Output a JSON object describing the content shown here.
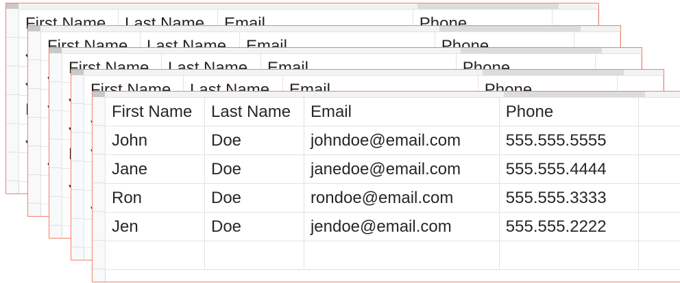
{
  "spreadsheet": {
    "columns": [
      "First Name",
      "Last Name",
      "Email",
      "Phone"
    ],
    "rows": [
      [
        "John",
        "Doe",
        "johndoe@email.com",
        "555.555.5555"
      ],
      [
        "Jane",
        "Doe",
        "janedoe@email.com",
        "555.555.4444"
      ],
      [
        "Ron",
        "Doe",
        "rondoe@email.com",
        "555.555.3333"
      ],
      [
        "Jen",
        "Doe",
        "jendoe@email.com",
        "555.555.2222"
      ]
    ]
  },
  "colors": {
    "sheet_border": "#f2806a",
    "grid_line": "#e2e2e2",
    "header_bar": "#f3f3f3",
    "text": "#262626"
  }
}
